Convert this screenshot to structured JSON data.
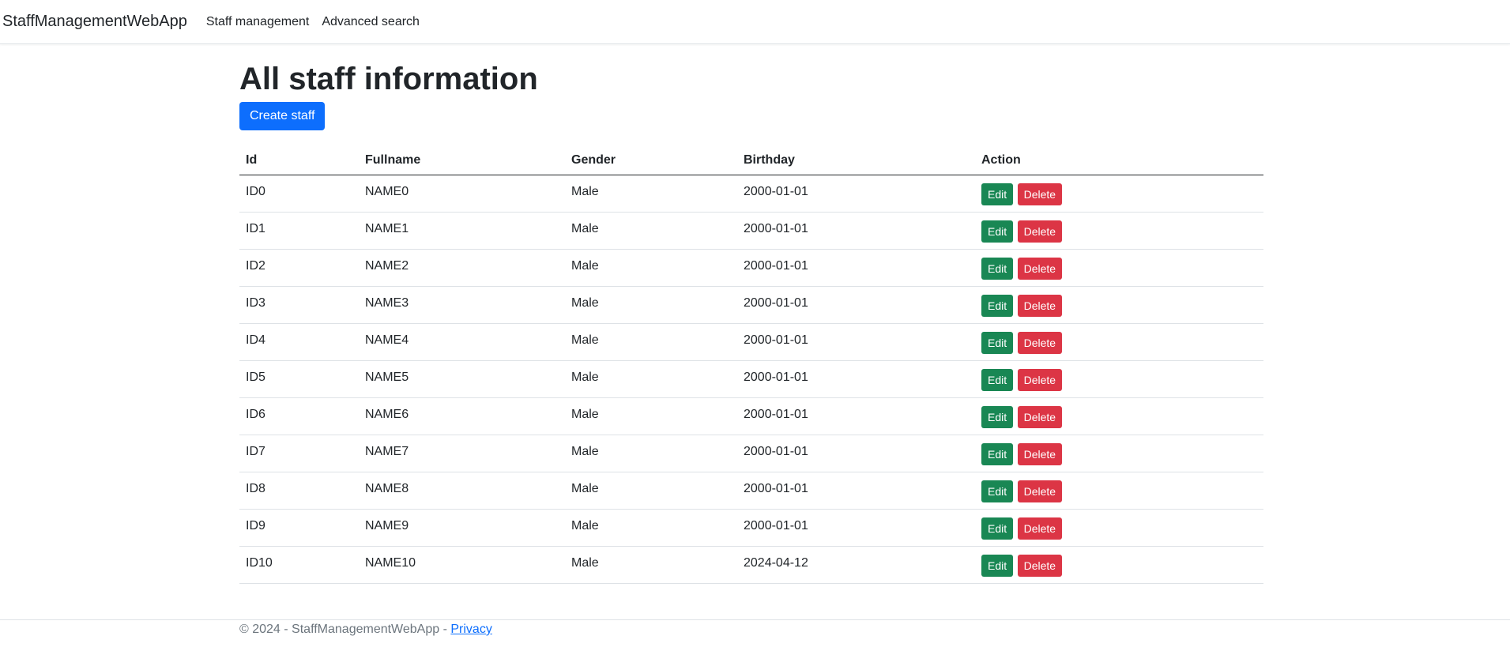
{
  "navbar": {
    "brand": "StaffManagementWebApp",
    "links": [
      "Staff management",
      "Advanced search"
    ]
  },
  "page": {
    "title": "All staff information",
    "create_button": "Create staff"
  },
  "table": {
    "headers": [
      "Id",
      "Fullname",
      "Gender",
      "Birthday",
      "Action"
    ],
    "edit_label": "Edit",
    "delete_label": "Delete",
    "rows": [
      {
        "id": "ID0",
        "fullname": "NAME0",
        "gender": "Male",
        "birthday": "2000-01-01"
      },
      {
        "id": "ID1",
        "fullname": "NAME1",
        "gender": "Male",
        "birthday": "2000-01-01"
      },
      {
        "id": "ID2",
        "fullname": "NAME2",
        "gender": "Male",
        "birthday": "2000-01-01"
      },
      {
        "id": "ID3",
        "fullname": "NAME3",
        "gender": "Male",
        "birthday": "2000-01-01"
      },
      {
        "id": "ID4",
        "fullname": "NAME4",
        "gender": "Male",
        "birthday": "2000-01-01"
      },
      {
        "id": "ID5",
        "fullname": "NAME5",
        "gender": "Male",
        "birthday": "2000-01-01"
      },
      {
        "id": "ID6",
        "fullname": "NAME6",
        "gender": "Male",
        "birthday": "2000-01-01"
      },
      {
        "id": "ID7",
        "fullname": "NAME7",
        "gender": "Male",
        "birthday": "2000-01-01"
      },
      {
        "id": "ID8",
        "fullname": "NAME8",
        "gender": "Male",
        "birthday": "2000-01-01"
      },
      {
        "id": "ID9",
        "fullname": "NAME9",
        "gender": "Male",
        "birthday": "2000-01-01"
      },
      {
        "id": "ID10",
        "fullname": "NAME10",
        "gender": "Male",
        "birthday": "2024-04-12"
      }
    ]
  },
  "footer": {
    "text": "© 2024 - StaffManagementWebApp - ",
    "privacy_link": "Privacy"
  },
  "colors": {
    "primary": "#0d6efd",
    "success": "#198754",
    "danger": "#dc3545"
  }
}
